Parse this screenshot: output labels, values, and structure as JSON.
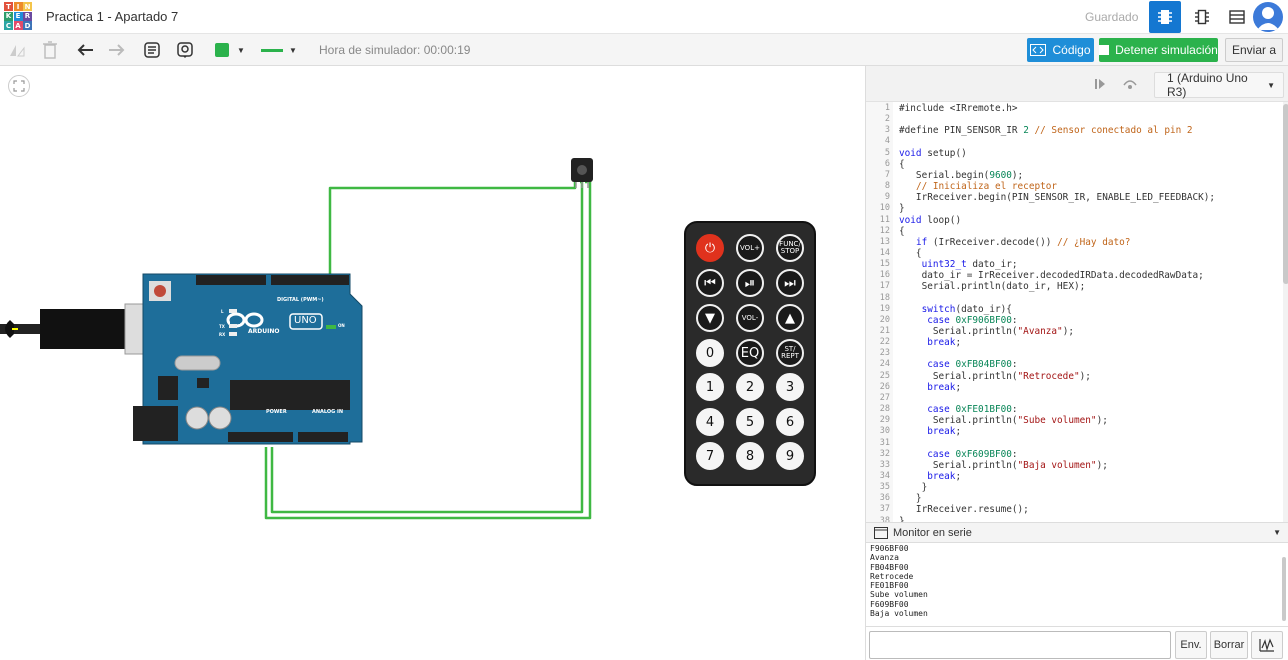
{
  "logo_letters": [
    "T",
    "I",
    "N",
    "K",
    "E",
    "R",
    "C",
    "A",
    "D"
  ],
  "logo_colors": [
    "#e1523d",
    "#ed8b2b",
    "#f4c54b",
    "#2d9d6b",
    "#1f8ed8",
    "#6a4aa0",
    "#2ca6a4",
    "#e24b6b",
    "#3d74b8"
  ],
  "header": {
    "title": "Practica 1 - Apartado 7",
    "saved_status": "Guardado"
  },
  "toolbar": {
    "sim_time": "Hora de simulador: 00:00:19",
    "code_button": "Código",
    "stop_button": "Detener simulación",
    "send_button": "Enviar a"
  },
  "code_panel": {
    "board_select": "1 (Arduino Uno R3)",
    "code_lines": [
      "#include <IRremote.h>",
      "",
      "#define PIN_SENSOR_IR 2 // Sensor conectado al pin 2",
      "",
      "void setup()",
      "{",
      "   Serial.begin(9600);",
      "   // Inicializa el receptor",
      "   IrReceiver.begin(PIN_SENSOR_IR, ENABLE_LED_FEEDBACK);",
      "}",
      "void loop()",
      "{",
      "   if (IrReceiver.decode()) // ¿Hay dato?",
      "   {",
      "    uint32_t dato_ir;",
      "    dato_ir = IrReceiver.decodedIRData.decodedRawData;",
      "    Serial.println(dato_ir, HEX);",
      "",
      "    switch(dato_ir){",
      "     case 0xF906BF00:",
      "      Serial.println(\"Avanza\");",
      "     break;",
      "",
      "     case 0xFB04BF00:",
      "      Serial.println(\"Retrocede\");",
      "     break;",
      "",
      "     case 0xFE01BF00:",
      "      Serial.println(\"Sube volumen\");",
      "     break;",
      "",
      "     case 0xF609BF00:",
      "      Serial.println(\"Baja volumen\");",
      "     break;",
      "    }",
      "   }",
      "   IrReceiver.resume();",
      "}"
    ],
    "serial_monitor_label": "Monitor en serie",
    "serial_output": [
      "F906BF00",
      "Avanza",
      "FB04BF00",
      "Retrocede",
      "FE01BF00",
      "Sube volumen",
      "F609BF00",
      "Baja volumen"
    ],
    "send_label": "Env.",
    "clear_label": "Borrar"
  },
  "arduino": {
    "brand": "ARDUINO",
    "model": "UNO",
    "digital_label": "DIGITAL (PWM~)",
    "power_label": "POWER",
    "analog_label": "ANALOG IN",
    "on_label": "ON",
    "tx_label": "TX",
    "rx_label": "RX",
    "l_label": "L"
  },
  "remote": {
    "buttons": [
      [
        "⏻",
        "VOL+",
        "FUNC/\nSTOP"
      ],
      [
        "⏮",
        "⏯",
        "⏭"
      ],
      [
        "▼",
        "VOL-",
        "▲"
      ],
      [
        "0",
        "EQ",
        "ST/\nREPT"
      ],
      [
        "1",
        "2",
        "3"
      ],
      [
        "4",
        "5",
        "6"
      ],
      [
        "7",
        "8",
        "9"
      ]
    ]
  },
  "colors": {
    "accent_blue": "#1477d1",
    "stop_green": "#2bb24c",
    "wire_green": "#3fb843",
    "board_blue": "#1e6e9a",
    "power_red": "#e0321d"
  }
}
